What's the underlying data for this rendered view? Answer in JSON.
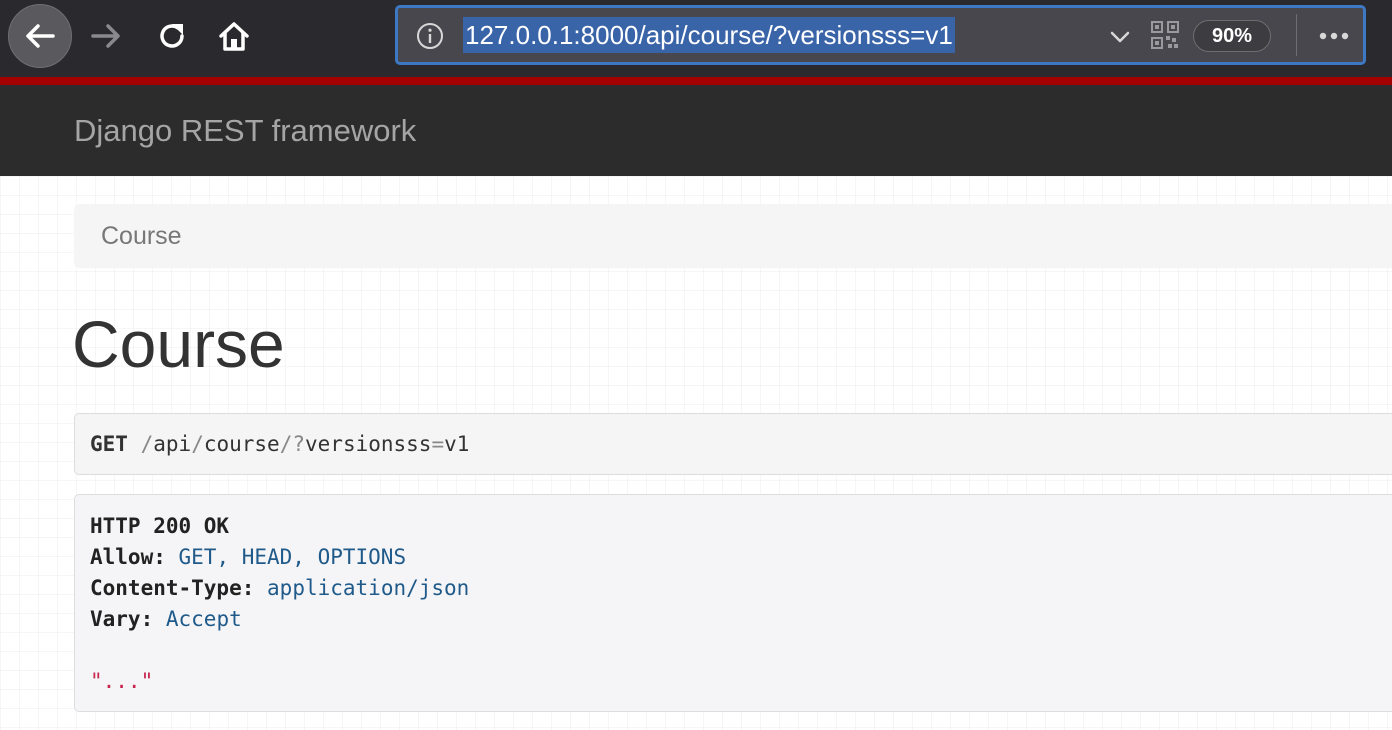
{
  "browser": {
    "url": "127.0.0.1:8000/api/course/?versionsss=v1",
    "zoom": "90%",
    "icons": [
      "back-arrow-icon",
      "forward-arrow-icon",
      "reload-icon",
      "home-icon",
      "info-icon",
      "chevron-down-icon",
      "qr-code-icon",
      "more-icon"
    ]
  },
  "navbar": {
    "brand": "Django REST framework"
  },
  "breadcrumb": {
    "items": [
      "Course"
    ]
  },
  "page": {
    "title": "Course"
  },
  "request": {
    "method": "GET",
    "path_slash1": "/",
    "path_seg1": "api",
    "path_slash2": "/",
    "path_seg2": "course",
    "path_slash3": "/",
    "query_q": "?",
    "query_key": "versionsss",
    "query_eq": "=",
    "query_val": "v1"
  },
  "response": {
    "status": "HTTP 200 OK",
    "headers": [
      {
        "key": "Allow:",
        "value": "GET, HEAD, OPTIONS"
      },
      {
        "key": "Content-Type:",
        "value": "application/json"
      },
      {
        "key": "Vary:",
        "value": "Accept"
      }
    ],
    "body": "\"...\""
  },
  "colors": {
    "toolbar": "#2a2a2e",
    "url_highlight": "#3a64a8",
    "drf_red": "#a30000",
    "navbar": "#2c2c2c",
    "header_value": "#1f5a8a",
    "body_string": "#c7254e"
  }
}
